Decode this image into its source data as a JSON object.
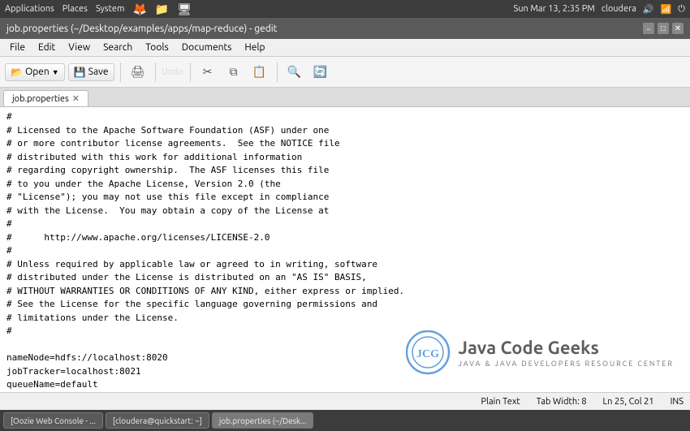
{
  "system_bar": {
    "apps": "Applications",
    "places": "Places",
    "system": "System",
    "datetime": "Sun Mar 13,  2:35 PM",
    "user": "cloudera"
  },
  "title_bar": {
    "title": "job.properties (~/Desktop/examples/apps/map-reduce) - gedit",
    "min": "−",
    "max": "□",
    "close": "✕"
  },
  "menu_bar": {
    "items": [
      "File",
      "Edit",
      "View",
      "Search",
      "Tools",
      "Documents",
      "Help"
    ]
  },
  "toolbar": {
    "open_label": "Open",
    "save_label": "Save",
    "undo_label": "Undo"
  },
  "tab": {
    "label": "job.properties",
    "close": "✕"
  },
  "editor": {
    "content": "#\n# Licensed to the Apache Software Foundation (ASF) under one\n# or more contributor license agreements.  See the NOTICE file\n# distributed with this work for additional information\n# regarding copyright ownership.  The ASF licenses this file\n# to you under the Apache License, Version 2.0 (the\n# \"License\"); you may not use this file except in compliance\n# with the License.  You may obtain a copy of the License at\n#\n#      http://www.apache.org/licenses/LICENSE-2.0\n#\n# Unless required by applicable law or agreed to in writing, software\n# distributed under the License is distributed on an \"AS IS\" BASIS,\n# WITHOUT WARRANTIES OR CONDITIONS OF ANY KIND, either express or implied.\n# See the License for the specific language governing permissions and\n# limitations under the License.\n#\n\nnameNode=hdfs://localhost:8020\njobTracker=localhost:8021\nqueueName=default\nexamplesRoot=examples\n\noozie.wf.application.path=${nameNode}/user/${user.name}/${examplesRoot}/apps/map-reduce/workflow.xml\noutputDir=map-reduce"
  },
  "watermark": {
    "title": "Java Code Geeks",
    "subtitle": "Java & Java Developers Resource Center"
  },
  "status_bar": {
    "format": "Plain Text",
    "tab_width": "Tab Width: 8",
    "position": "Ln 25, Col 21",
    "mode": "INS"
  },
  "taskbar": {
    "items": [
      "[Oozie Web Console - ...",
      "[cloudera@quickstart: ~]",
      "job.properties (~/Desk..."
    ]
  }
}
